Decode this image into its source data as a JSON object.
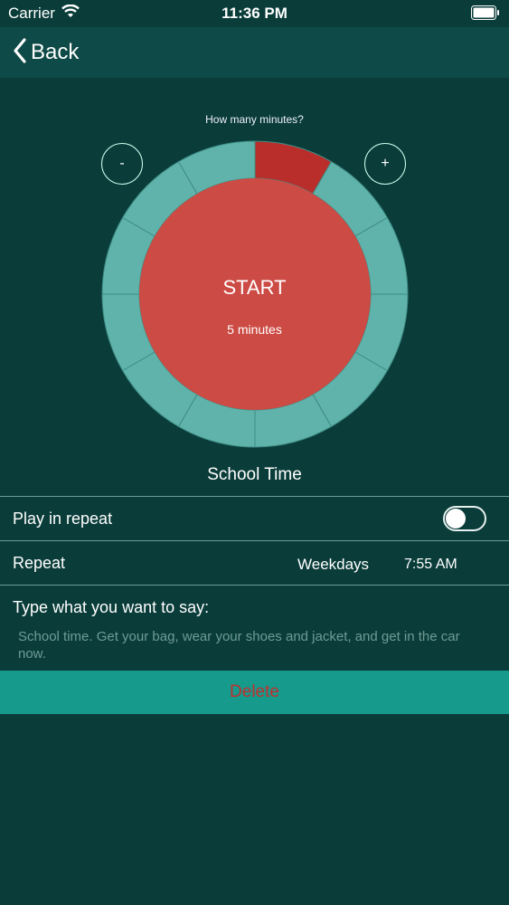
{
  "status_bar": {
    "carrier": "Carrier",
    "time": "11:36 PM",
    "wifi_icon": "wifi-icon",
    "battery_icon": "battery-icon"
  },
  "nav": {
    "back_label": "Back",
    "back_icon": "chevron-left-icon"
  },
  "timer": {
    "prompt": "How many minutes?",
    "minus_label": "-",
    "plus_label": "+",
    "start_label": "START",
    "minutes_label": "5 minutes",
    "selected_segments": 1,
    "total_segments": 12,
    "name": "School Time"
  },
  "settings": {
    "play_in_repeat_label": "Play in repeat",
    "play_in_repeat_on": false,
    "repeat_label": "Repeat",
    "repeat_days": "Weekdays",
    "repeat_time": "7:55 AM",
    "message_label": "Type what you want to say:",
    "message_text": "School time. Get your bag, wear your shoes and jacket, and get in the car now."
  },
  "actions": {
    "delete_label": "Delete"
  },
  "colors": {
    "background": "#0a3d3a",
    "nav": "#0e4a47",
    "ring": "#5fb3aa",
    "ring_selected": "#b92e2b",
    "inner_circle": "#cc4b44",
    "delete_bg": "#159a8b",
    "delete_text": "#c0302f"
  }
}
